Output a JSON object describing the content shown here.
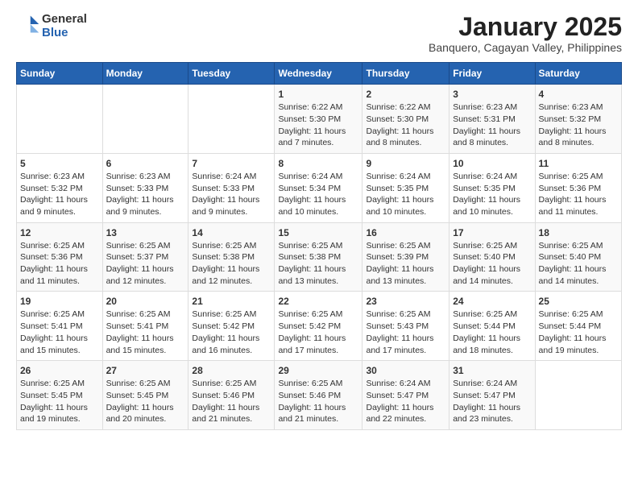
{
  "logo": {
    "general": "General",
    "blue": "Blue"
  },
  "header": {
    "title": "January 2025",
    "subtitle": "Banquero, Cagayan Valley, Philippines"
  },
  "days_of_week": [
    "Sunday",
    "Monday",
    "Tuesday",
    "Wednesday",
    "Thursday",
    "Friday",
    "Saturday"
  ],
  "weeks": [
    [
      {
        "day": "",
        "info": ""
      },
      {
        "day": "",
        "info": ""
      },
      {
        "day": "",
        "info": ""
      },
      {
        "day": "1",
        "info": "Sunrise: 6:22 AM\nSunset: 5:30 PM\nDaylight: 11 hours and 7 minutes."
      },
      {
        "day": "2",
        "info": "Sunrise: 6:22 AM\nSunset: 5:30 PM\nDaylight: 11 hours and 8 minutes."
      },
      {
        "day": "3",
        "info": "Sunrise: 6:23 AM\nSunset: 5:31 PM\nDaylight: 11 hours and 8 minutes."
      },
      {
        "day": "4",
        "info": "Sunrise: 6:23 AM\nSunset: 5:32 PM\nDaylight: 11 hours and 8 minutes."
      }
    ],
    [
      {
        "day": "5",
        "info": "Sunrise: 6:23 AM\nSunset: 5:32 PM\nDaylight: 11 hours and 9 minutes."
      },
      {
        "day": "6",
        "info": "Sunrise: 6:23 AM\nSunset: 5:33 PM\nDaylight: 11 hours and 9 minutes."
      },
      {
        "day": "7",
        "info": "Sunrise: 6:24 AM\nSunset: 5:33 PM\nDaylight: 11 hours and 9 minutes."
      },
      {
        "day": "8",
        "info": "Sunrise: 6:24 AM\nSunset: 5:34 PM\nDaylight: 11 hours and 10 minutes."
      },
      {
        "day": "9",
        "info": "Sunrise: 6:24 AM\nSunset: 5:35 PM\nDaylight: 11 hours and 10 minutes."
      },
      {
        "day": "10",
        "info": "Sunrise: 6:24 AM\nSunset: 5:35 PM\nDaylight: 11 hours and 10 minutes."
      },
      {
        "day": "11",
        "info": "Sunrise: 6:25 AM\nSunset: 5:36 PM\nDaylight: 11 hours and 11 minutes."
      }
    ],
    [
      {
        "day": "12",
        "info": "Sunrise: 6:25 AM\nSunset: 5:36 PM\nDaylight: 11 hours and 11 minutes."
      },
      {
        "day": "13",
        "info": "Sunrise: 6:25 AM\nSunset: 5:37 PM\nDaylight: 11 hours and 12 minutes."
      },
      {
        "day": "14",
        "info": "Sunrise: 6:25 AM\nSunset: 5:38 PM\nDaylight: 11 hours and 12 minutes."
      },
      {
        "day": "15",
        "info": "Sunrise: 6:25 AM\nSunset: 5:38 PM\nDaylight: 11 hours and 13 minutes."
      },
      {
        "day": "16",
        "info": "Sunrise: 6:25 AM\nSunset: 5:39 PM\nDaylight: 11 hours and 13 minutes."
      },
      {
        "day": "17",
        "info": "Sunrise: 6:25 AM\nSunset: 5:40 PM\nDaylight: 11 hours and 14 minutes."
      },
      {
        "day": "18",
        "info": "Sunrise: 6:25 AM\nSunset: 5:40 PM\nDaylight: 11 hours and 14 minutes."
      }
    ],
    [
      {
        "day": "19",
        "info": "Sunrise: 6:25 AM\nSunset: 5:41 PM\nDaylight: 11 hours and 15 minutes."
      },
      {
        "day": "20",
        "info": "Sunrise: 6:25 AM\nSunset: 5:41 PM\nDaylight: 11 hours and 15 minutes."
      },
      {
        "day": "21",
        "info": "Sunrise: 6:25 AM\nSunset: 5:42 PM\nDaylight: 11 hours and 16 minutes."
      },
      {
        "day": "22",
        "info": "Sunrise: 6:25 AM\nSunset: 5:42 PM\nDaylight: 11 hours and 17 minutes."
      },
      {
        "day": "23",
        "info": "Sunrise: 6:25 AM\nSunset: 5:43 PM\nDaylight: 11 hours and 17 minutes."
      },
      {
        "day": "24",
        "info": "Sunrise: 6:25 AM\nSunset: 5:44 PM\nDaylight: 11 hours and 18 minutes."
      },
      {
        "day": "25",
        "info": "Sunrise: 6:25 AM\nSunset: 5:44 PM\nDaylight: 11 hours and 19 minutes."
      }
    ],
    [
      {
        "day": "26",
        "info": "Sunrise: 6:25 AM\nSunset: 5:45 PM\nDaylight: 11 hours and 19 minutes."
      },
      {
        "day": "27",
        "info": "Sunrise: 6:25 AM\nSunset: 5:45 PM\nDaylight: 11 hours and 20 minutes."
      },
      {
        "day": "28",
        "info": "Sunrise: 6:25 AM\nSunset: 5:46 PM\nDaylight: 11 hours and 21 minutes."
      },
      {
        "day": "29",
        "info": "Sunrise: 6:25 AM\nSunset: 5:46 PM\nDaylight: 11 hours and 21 minutes."
      },
      {
        "day": "30",
        "info": "Sunrise: 6:24 AM\nSunset: 5:47 PM\nDaylight: 11 hours and 22 minutes."
      },
      {
        "day": "31",
        "info": "Sunrise: 6:24 AM\nSunset: 5:47 PM\nDaylight: 11 hours and 23 minutes."
      },
      {
        "day": "",
        "info": ""
      }
    ]
  ]
}
